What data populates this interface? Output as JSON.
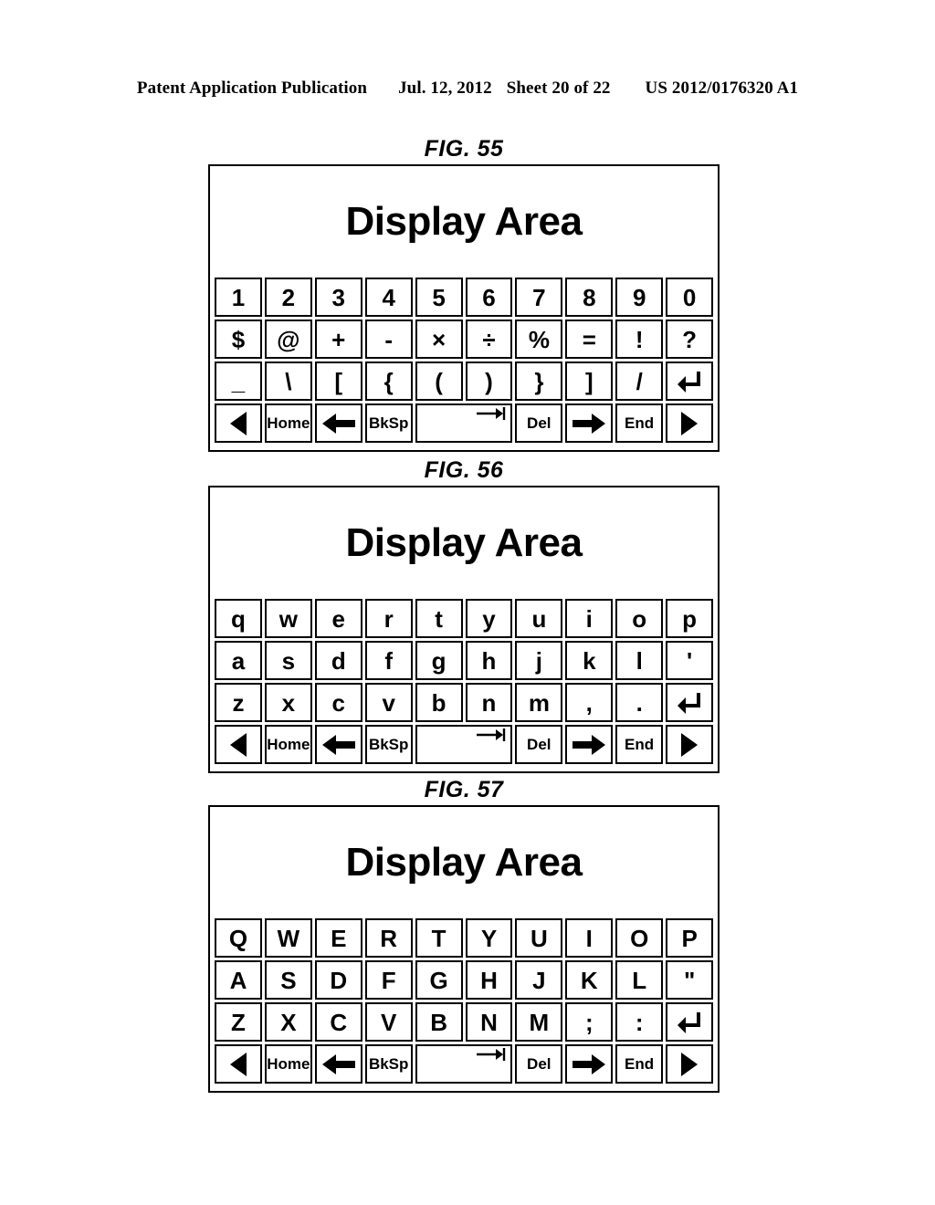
{
  "header": {
    "publication": "Patent Application Publication",
    "date": "Jul. 12, 2012",
    "sheet": "Sheet 20 of 22",
    "patent_number": "US 2012/0176320 A1"
  },
  "figures": [
    {
      "label": "FIG. 55",
      "display_area_text": "Display Area",
      "rows": [
        {
          "name": "numeric-row",
          "keys": [
            {
              "label": "1",
              "name": "key-1"
            },
            {
              "label": "2",
              "name": "key-2"
            },
            {
              "label": "3",
              "name": "key-3"
            },
            {
              "label": "4",
              "name": "key-4"
            },
            {
              "label": "5",
              "name": "key-5"
            },
            {
              "label": "6",
              "name": "key-6"
            },
            {
              "label": "7",
              "name": "key-7"
            },
            {
              "label": "8",
              "name": "key-8"
            },
            {
              "label": "9",
              "name": "key-9"
            },
            {
              "label": "0",
              "name": "key-0"
            }
          ]
        },
        {
          "name": "symbol-row-1",
          "keys": [
            {
              "label": "$",
              "name": "key-dollar"
            },
            {
              "label": "@",
              "name": "key-at"
            },
            {
              "label": "+",
              "name": "key-plus"
            },
            {
              "label": "-",
              "name": "key-minus"
            },
            {
              "label": "×",
              "name": "key-multiply"
            },
            {
              "label": "÷",
              "name": "key-divide"
            },
            {
              "label": "%",
              "name": "key-percent"
            },
            {
              "label": "=",
              "name": "key-equals"
            },
            {
              "label": "!",
              "name": "key-exclamation"
            },
            {
              "label": "?",
              "name": "key-question"
            }
          ]
        },
        {
          "name": "symbol-row-2",
          "keys": [
            {
              "label": "_",
              "name": "key-underscore"
            },
            {
              "label": "\\",
              "name": "key-backslash"
            },
            {
              "label": "[",
              "name": "key-bracket-left"
            },
            {
              "label": "{",
              "name": "key-brace-left"
            },
            {
              "label": "(",
              "name": "key-paren-left"
            },
            {
              "label": ")",
              "name": "key-paren-right"
            },
            {
              "label": "}",
              "name": "key-brace-right"
            },
            {
              "label": "]",
              "name": "key-bracket-right"
            },
            {
              "label": "/",
              "name": "key-slash"
            },
            {
              "label": "",
              "name": "key-enter",
              "icon": "enter-icon"
            }
          ]
        }
      ]
    },
    {
      "label": "FIG. 56",
      "display_area_text": "Display Area",
      "rows": [
        {
          "name": "letter-row-1",
          "keys": [
            {
              "label": "q",
              "name": "key-q"
            },
            {
              "label": "w",
              "name": "key-w"
            },
            {
              "label": "e",
              "name": "key-e"
            },
            {
              "label": "r",
              "name": "key-r"
            },
            {
              "label": "t",
              "name": "key-t"
            },
            {
              "label": "y",
              "name": "key-y"
            },
            {
              "label": "u",
              "name": "key-u"
            },
            {
              "label": "i",
              "name": "key-i"
            },
            {
              "label": "o",
              "name": "key-o"
            },
            {
              "label": "p",
              "name": "key-p"
            }
          ]
        },
        {
          "name": "letter-row-2",
          "keys": [
            {
              "label": "a",
              "name": "key-a"
            },
            {
              "label": "s",
              "name": "key-s"
            },
            {
              "label": "d",
              "name": "key-d"
            },
            {
              "label": "f",
              "name": "key-f"
            },
            {
              "label": "g",
              "name": "key-g"
            },
            {
              "label": "h",
              "name": "key-h"
            },
            {
              "label": "j",
              "name": "key-j"
            },
            {
              "label": "k",
              "name": "key-k"
            },
            {
              "label": "l",
              "name": "key-l"
            },
            {
              "label": "'",
              "name": "key-apostrophe"
            }
          ]
        },
        {
          "name": "letter-row-3",
          "keys": [
            {
              "label": "z",
              "name": "key-z"
            },
            {
              "label": "x",
              "name": "key-x"
            },
            {
              "label": "c",
              "name": "key-c"
            },
            {
              "label": "v",
              "name": "key-v"
            },
            {
              "label": "b",
              "name": "key-b"
            },
            {
              "label": "n",
              "name": "key-n"
            },
            {
              "label": "m",
              "name": "key-m"
            },
            {
              "label": ",",
              "name": "key-comma"
            },
            {
              "label": ".",
              "name": "key-period"
            },
            {
              "label": "",
              "name": "key-enter",
              "icon": "enter-icon"
            }
          ]
        }
      ]
    },
    {
      "label": "FIG. 57",
      "display_area_text": "Display Area",
      "rows": [
        {
          "name": "letter-row-1",
          "keys": [
            {
              "label": "Q",
              "name": "key-q-upper"
            },
            {
              "label": "W",
              "name": "key-w-upper"
            },
            {
              "label": "E",
              "name": "key-e-upper"
            },
            {
              "label": "R",
              "name": "key-r-upper"
            },
            {
              "label": "T",
              "name": "key-t-upper"
            },
            {
              "label": "Y",
              "name": "key-y-upper"
            },
            {
              "label": "U",
              "name": "key-u-upper"
            },
            {
              "label": "I",
              "name": "key-i-upper"
            },
            {
              "label": "O",
              "name": "key-o-upper"
            },
            {
              "label": "P",
              "name": "key-p-upper"
            }
          ]
        },
        {
          "name": "letter-row-2",
          "keys": [
            {
              "label": "A",
              "name": "key-a-upper"
            },
            {
              "label": "S",
              "name": "key-s-upper"
            },
            {
              "label": "D",
              "name": "key-d-upper"
            },
            {
              "label": "F",
              "name": "key-f-upper"
            },
            {
              "label": "G",
              "name": "key-g-upper"
            },
            {
              "label": "H",
              "name": "key-h-upper"
            },
            {
              "label": "J",
              "name": "key-j-upper"
            },
            {
              "label": "K",
              "name": "key-k-upper"
            },
            {
              "label": "L",
              "name": "key-l-upper"
            },
            {
              "label": "\"",
              "name": "key-quote"
            }
          ]
        },
        {
          "name": "letter-row-3",
          "keys": [
            {
              "label": "Z",
              "name": "key-z-upper"
            },
            {
              "label": "X",
              "name": "key-x-upper"
            },
            {
              "label": "C",
              "name": "key-c-upper"
            },
            {
              "label": "V",
              "name": "key-v-upper"
            },
            {
              "label": "B",
              "name": "key-b-upper"
            },
            {
              "label": "N",
              "name": "key-n-upper"
            },
            {
              "label": "M",
              "name": "key-m-upper"
            },
            {
              "label": ";",
              "name": "key-semicolon"
            },
            {
              "label": ":",
              "name": "key-colon"
            },
            {
              "label": "",
              "name": "key-enter",
              "icon": "enter-icon"
            }
          ]
        }
      ]
    }
  ],
  "navigation_row": {
    "name": "navigation-row",
    "keys": [
      {
        "label": "",
        "name": "key-cursor-left",
        "icon": "triangle-left-icon"
      },
      {
        "label": "Home",
        "name": "key-home"
      },
      {
        "label": "",
        "name": "key-left-arrow",
        "icon": "arrow-left-icon"
      },
      {
        "label": "BkSp",
        "name": "key-backspace"
      },
      {
        "label": "",
        "name": "key-space-tab",
        "icon": "tab-arrow-icon"
      },
      {
        "label": "Del",
        "name": "key-delete"
      },
      {
        "label": "",
        "name": "key-right-arrow",
        "icon": "arrow-right-icon"
      },
      {
        "label": "End",
        "name": "key-end"
      },
      {
        "label": "",
        "name": "key-cursor-right",
        "icon": "triangle-right-icon"
      }
    ]
  },
  "colors": {
    "ink": "#000000",
    "paper": "#ffffff"
  }
}
